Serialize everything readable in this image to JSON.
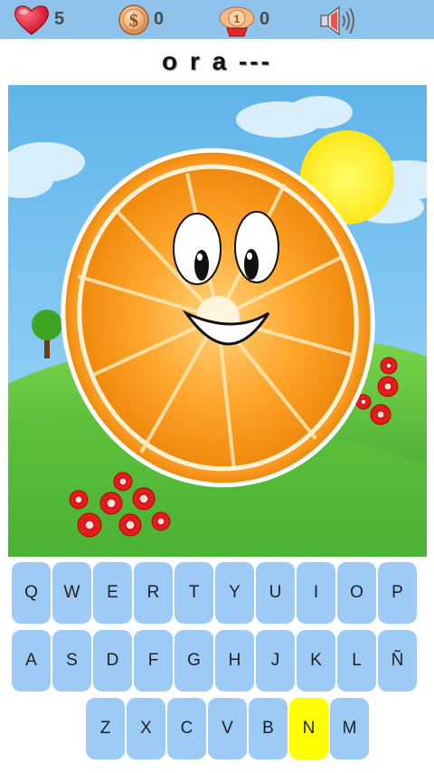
{
  "stats": {
    "lives": "5",
    "coins": "0",
    "hints": "0"
  },
  "icons": {
    "lives": "heart-icon",
    "coins": "dollar-coin-icon",
    "hints": "hint-character-icon",
    "sound": "speaker-sound-icon"
  },
  "word": "o r a ---",
  "picture": {
    "subject": "smiling orange half"
  },
  "keyboard": {
    "rows": [
      [
        "Q",
        "W",
        "E",
        "R",
        "T",
        "Y",
        "U",
        "I",
        "O",
        "P"
      ],
      [
        "A",
        "S",
        "D",
        "F",
        "G",
        "H",
        "J",
        "K",
        "L",
        "Ñ"
      ],
      [
        "Z",
        "X",
        "C",
        "V",
        "B",
        "N",
        "M"
      ]
    ],
    "selected_key": "N"
  },
  "colors": {
    "topbar": "#90c3ec",
    "key": "#9dcbf5",
    "key_selected": "#ffff00"
  }
}
